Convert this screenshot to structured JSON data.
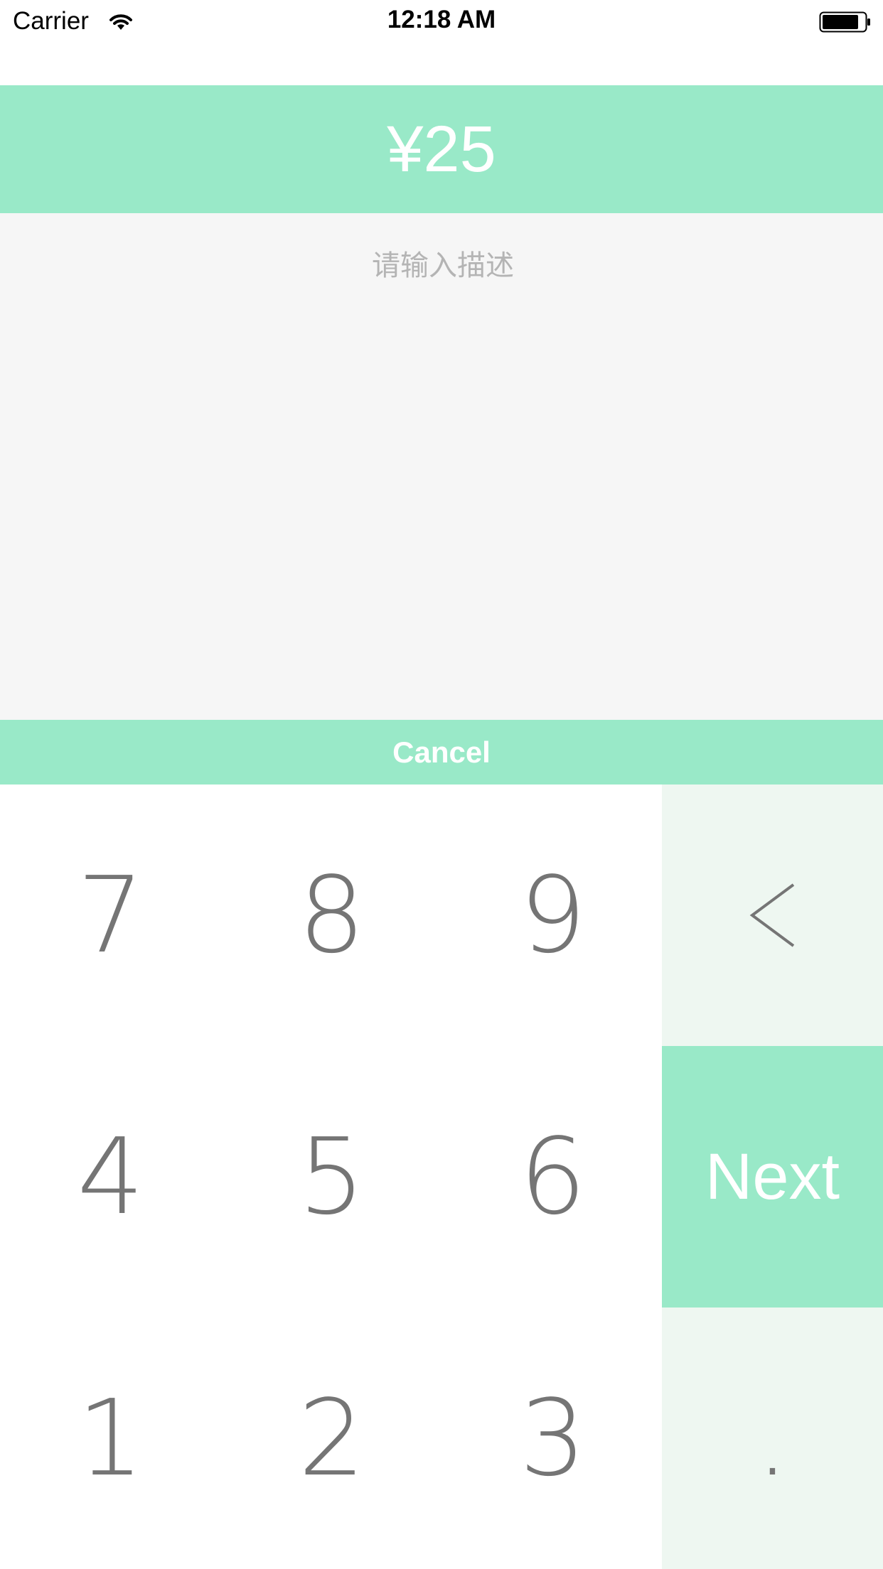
{
  "status_bar": {
    "carrier": "Carrier",
    "time": "12:18 AM",
    "wifi_icon": "wifi-icon",
    "battery_icon": "battery-icon"
  },
  "header": {
    "amount": "¥25"
  },
  "description": {
    "placeholder": "请输入描述",
    "value": ""
  },
  "cancel_label": "Cancel",
  "keypad": {
    "k7": "7",
    "k8": "8",
    "k9": "9",
    "k4": "4",
    "k5": "5",
    "k6": "6",
    "k1": "1",
    "k2": "2",
    "k3": "3",
    "backspace": "<",
    "next": "Next",
    "dot": "."
  },
  "colors": {
    "accent": "#99e9c8",
    "side_key_bg": "#eef7f1",
    "desc_bg": "#f6f6f6",
    "key_text": "#757575",
    "placeholder": "#b4b4b4"
  }
}
